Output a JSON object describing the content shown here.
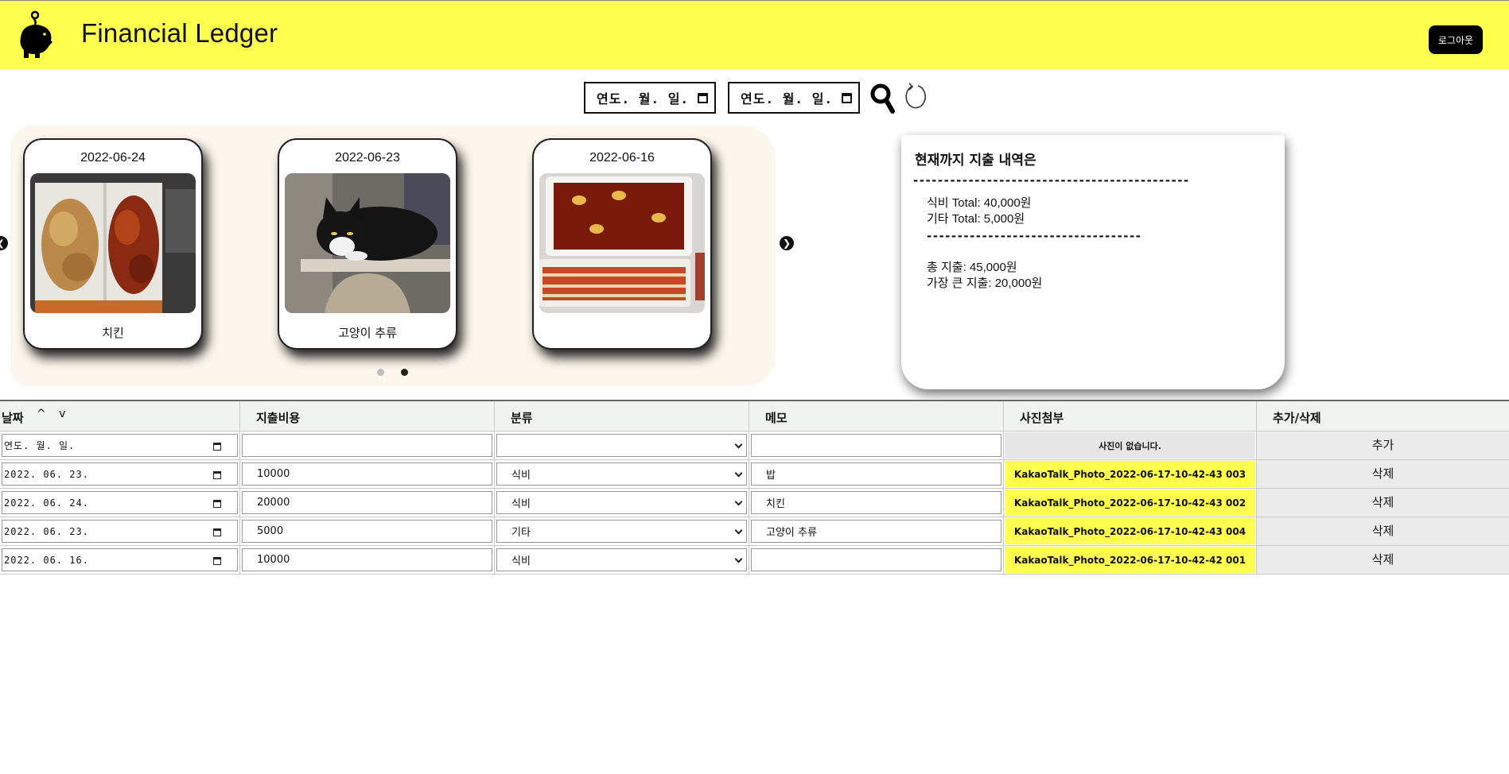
{
  "header": {
    "title": "Financial Ledger",
    "logout_label": "로그아웃",
    "logo_icon": "piggy-bank-icon",
    "background": "#ffff4d"
  },
  "filter": {
    "start_date": "연도. 월. 일.",
    "end_date": "연도. 월. 일.",
    "search_icon": "search-icon",
    "refresh_icon": "refresh-icon"
  },
  "carousel": {
    "cards": [
      {
        "date": "2022-06-24",
        "label": "치킨",
        "image": "fried-chicken-photo"
      },
      {
        "date": "2022-06-23",
        "label": "고양이 추류",
        "image": "cat-photo"
      },
      {
        "date": "2022-06-16",
        "label": "",
        "image": "tteokbokki-photo"
      }
    ],
    "dots": 2,
    "active_dot": 1
  },
  "summary": {
    "heading": "현재까지 지출 내역은",
    "dash1": "---------------------------------------------",
    "food_total": "식비 Total: 40,000원",
    "other_total": "기타 Total: 5,000원",
    "dash2": "-----------------------------------",
    "grand_total": "총 지출: 45,000원",
    "largest": "가장 큰 지출: 20,000원"
  },
  "table": {
    "headers": {
      "date": "날짜",
      "sort": "^ v",
      "amount": "지출비용",
      "category": "분류",
      "memo": "메모",
      "photo": "사진첨부",
      "action": "추가/삭제"
    },
    "new_row": {
      "date": "연도. 월. 일.",
      "amount": "",
      "category": "",
      "memo": "",
      "photo": "사진이 없습니다.",
      "action": "추가"
    },
    "rows": [
      {
        "date": "2022. 06. 23.",
        "amount": "10000",
        "category": "식비",
        "memo": "밥",
        "photo": "KakaoTalk_Photo_2022-06-17-10-42-43 003",
        "action": "삭제"
      },
      {
        "date": "2022. 06. 24.",
        "amount": "20000",
        "category": "식비",
        "memo": "치킨",
        "photo": "KakaoTalk_Photo_2022-06-17-10-42-43 002",
        "action": "삭제"
      },
      {
        "date": "2022. 06. 23.",
        "amount": "5000",
        "category": "기타",
        "memo": "고양이 추류",
        "photo": "KakaoTalk_Photo_2022-06-17-10-42-43 004",
        "action": "삭제"
      },
      {
        "date": "2022. 06. 16.",
        "amount": "10000",
        "category": "식비",
        "memo": "",
        "photo": "KakaoTalk_Photo_2022-06-17-10-42-42 001",
        "action": "삭제"
      }
    ]
  }
}
